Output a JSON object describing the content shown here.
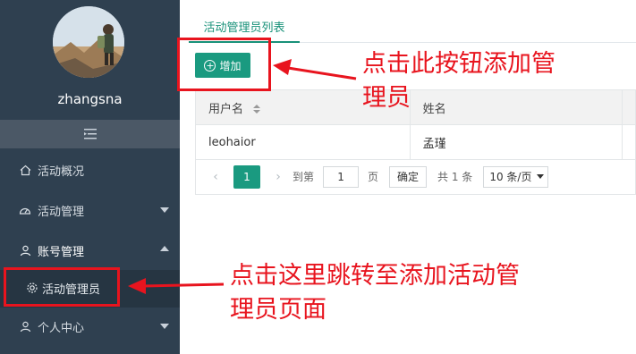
{
  "sidebar": {
    "username": "zhangsna",
    "menu": [
      {
        "label": "活动概况",
        "icon": "home-icon"
      },
      {
        "label": "活动管理",
        "icon": "dashboard-icon",
        "caret": "down"
      },
      {
        "label": "账号管理",
        "icon": "user-icon",
        "caret": "up"
      },
      {
        "label": "个人中心",
        "icon": "person-icon",
        "caret": "down"
      }
    ],
    "submenu": {
      "label": "活动管理员",
      "icon": "gear-icon"
    }
  },
  "main": {
    "tab": "活动管理员列表",
    "add_button": "增加",
    "table": {
      "headers": [
        "用户名",
        "姓名"
      ],
      "rows": [
        [
          "leohaior",
          "孟瑾"
        ]
      ]
    },
    "pager": {
      "current_page": "1",
      "goto_label": "到第",
      "goto_value": "1",
      "page_label": "页",
      "confirm": "确定",
      "total": "共 1 条",
      "page_size": "10 条/页"
    }
  },
  "annotations": {
    "top": [
      "点击此按钮添加管",
      "理员"
    ],
    "bottom": [
      "点击这里跳转至添加活动管",
      "理员页面"
    ],
    "color": "#e8141e"
  },
  "colors": {
    "sidebar": "#2f4050",
    "accent": "#1a9a80"
  }
}
